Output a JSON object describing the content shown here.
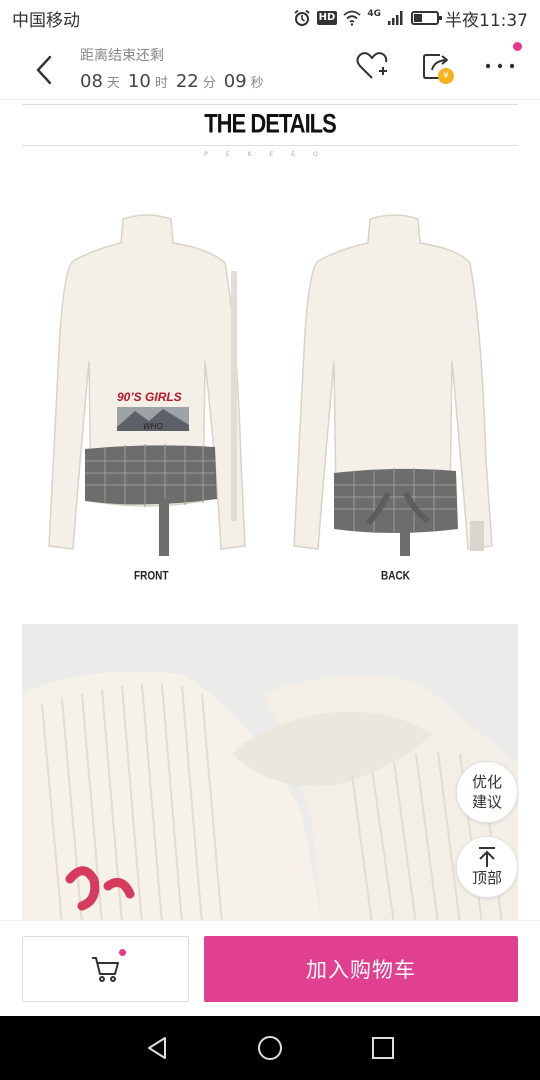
{
  "status_bar": {
    "carrier": "中国移动",
    "network": "4G",
    "time": "半夜11:37",
    "battery_level": 0.35
  },
  "header": {
    "countdown_label": "距离结束还剩",
    "countdown": {
      "days": "08",
      "days_unit": "天",
      "hours": "10",
      "hours_unit": "时",
      "minutes": "22",
      "minutes_unit": "分",
      "seconds": "09",
      "seconds_unit": "秒"
    },
    "icons": [
      "back-arrow-icon",
      "favorite-heart-icon",
      "share-icon",
      "more-icon"
    ]
  },
  "content": {
    "details_title": "THE DETAILS",
    "details_subtitle": "PEKEEO",
    "front_caption": "FRONT",
    "back_caption": "BACK",
    "print_text": "90’S GIRLS",
    "print_sub": "WHO"
  },
  "floating": {
    "suggest_line1": "优化",
    "suggest_line2": "建议",
    "top_label": "顶部"
  },
  "bottom_bar": {
    "add_to_cart": "加入购物车"
  },
  "colors": {
    "accent": "#e0408f",
    "badge_dot": "#e6398e",
    "coin": "#f5b21c"
  }
}
